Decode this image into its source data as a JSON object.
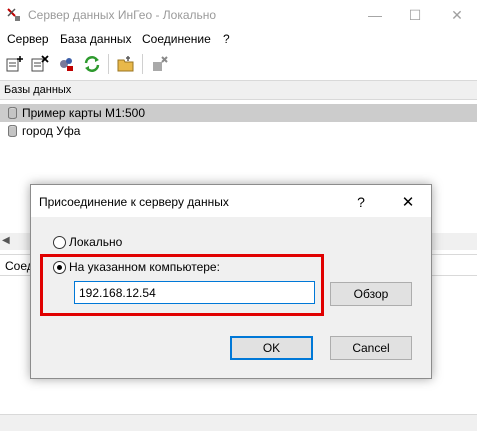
{
  "window": {
    "title": "Сервер данных ИнГео - Локально",
    "minimize": "—",
    "maximize": "☐",
    "close": "✕"
  },
  "menu": {
    "items": [
      "Сервер",
      "База данных",
      "Соединение",
      "?"
    ]
  },
  "toolbar": {
    "icons": [
      "add-db-icon",
      "delete-db-icon",
      "db-settings-icon",
      "refresh-icon",
      "folder-icon",
      "disconnect-icon"
    ]
  },
  "databases": {
    "header": "Базы данных",
    "items": [
      {
        "label": "Пример карты М1:500",
        "selected": true
      },
      {
        "label": "город Уфа",
        "selected": false
      }
    ]
  },
  "lower_panel": {
    "header_partial": "Соед"
  },
  "dialog": {
    "title": "Присоединение к серверу данных",
    "help": "?",
    "close": "✕",
    "radio_local": "Локально",
    "radio_remote": "На указанном компьютере:",
    "selected_option": "remote",
    "host_value": "192.168.12.54",
    "browse_label": "Обзор",
    "ok_label": "OK",
    "cancel_label": "Cancel"
  },
  "colors": {
    "highlight": "#e00000",
    "selection": "#cccccc",
    "focus": "#0078d7"
  }
}
